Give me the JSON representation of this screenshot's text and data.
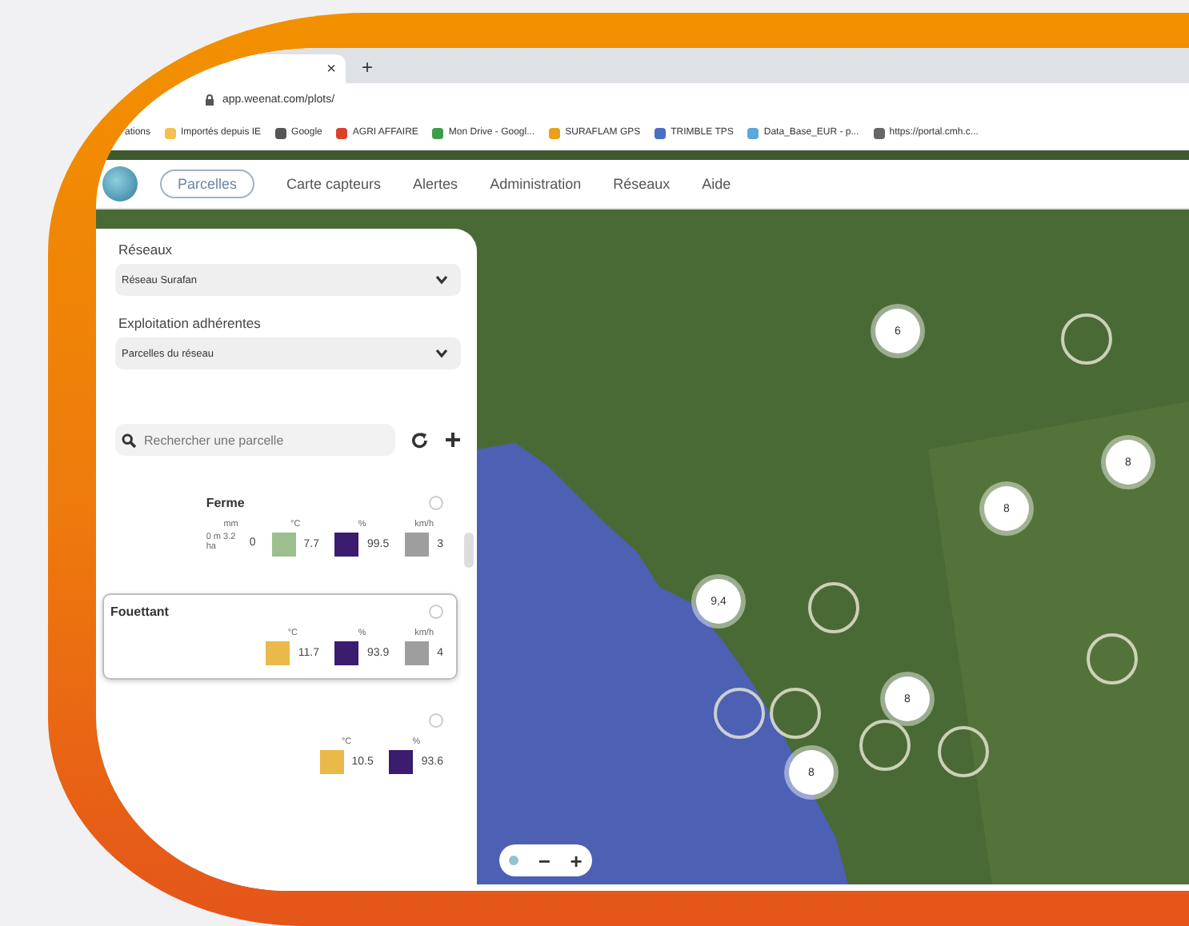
{
  "browser": {
    "tab_close": "×",
    "new_tab": "+",
    "address": "app.weenat.com/plots/",
    "bookmarks": [
      {
        "label": "ations"
      },
      {
        "label": "Importés depuis IE",
        "color": "#f2c14e"
      },
      {
        "label": "Google",
        "color": "#555555"
      },
      {
        "label": "AGRI AFFAIRE",
        "color": "#d9412b"
      },
      {
        "label": "Mon Drive - Googl...",
        "color": "#3f9c48"
      },
      {
        "label": "SURAFLAM GPS",
        "color": "#e7a21a"
      },
      {
        "label": "TRIMBLE TPS",
        "color": "#4a6fc4"
      },
      {
        "label": "Data_Base_EUR - p...",
        "color": "#5aa7d8"
      },
      {
        "label": "https://portal.cmh.c...",
        "color": "#666666"
      }
    ]
  },
  "nav": [
    {
      "label": "Parcelles",
      "selected": true
    },
    {
      "label": "Carte capteurs",
      "selected": false
    },
    {
      "label": "Alertes",
      "selected": false
    },
    {
      "label": "Administration",
      "selected": false
    },
    {
      "label": "Réseaux",
      "selected": false
    },
    {
      "label": "Aide",
      "selected": false
    }
  ],
  "sidebar": {
    "filters": [
      {
        "label": "Réseaux",
        "value": "Réseau Surafan"
      },
      {
        "label": "Exploitation adhérentes",
        "value": "Parcelles du réseau"
      }
    ],
    "search": {
      "placeholder": "Rechercher une parcelle"
    },
    "cards": [
      {
        "title": "Ferme",
        "selected": false,
        "metrics": [
          {
            "kind": "plain",
            "unit": "mm",
            "note": "0 m 3.2 ha",
            "value": "0"
          },
          {
            "kind": "swatch",
            "unit": "°C",
            "value": "7.7",
            "color": "#9dbf8f"
          },
          {
            "kind": "swatch",
            "unit": "%",
            "value": "99.5",
            "color": "#3b1c6e"
          },
          {
            "kind": "swatch",
            "unit": "km/h",
            "value": "3",
            "color": "#9e9e9e"
          }
        ]
      },
      {
        "title": "Fouettant",
        "selected": true,
        "metrics": [
          {
            "kind": "swatch",
            "unit": "°C",
            "value": "11.7",
            "color": "#e9b949"
          },
          {
            "kind": "swatch",
            "unit": "%",
            "value": "93.9",
            "color": "#3b1c6e"
          },
          {
            "kind": "swatch",
            "unit": "km/h",
            "value": "4",
            "color": "#9e9e9e"
          }
        ]
      },
      {
        "selected": false,
        "metrics": [
          {
            "kind": "swatch",
            "unit": "°C",
            "value": "10.5",
            "color": "#e9b949"
          },
          {
            "kind": "swatch",
            "unit": "%",
            "value": "93.6",
            "color": "#3b1c6e"
          }
        ]
      }
    ]
  },
  "map": {
    "markers": [
      {
        "kind": "cluster",
        "label": "6"
      },
      {
        "kind": "cluster",
        "label": "8"
      },
      {
        "kind": "cluster",
        "label": "8"
      },
      {
        "kind": "cluster",
        "label": "9,4"
      },
      {
        "kind": "cluster",
        "label": "8"
      },
      {
        "kind": "cluster",
        "label": "8"
      },
      {
        "kind": "ring"
      },
      {
        "kind": "ring"
      },
      {
        "kind": "ring"
      },
      {
        "kind": "ring"
      },
      {
        "kind": "ring"
      },
      {
        "kind": "ring"
      },
      {
        "kind": "ring"
      }
    ],
    "zoom_out": "−",
    "zoom_in": "+"
  }
}
